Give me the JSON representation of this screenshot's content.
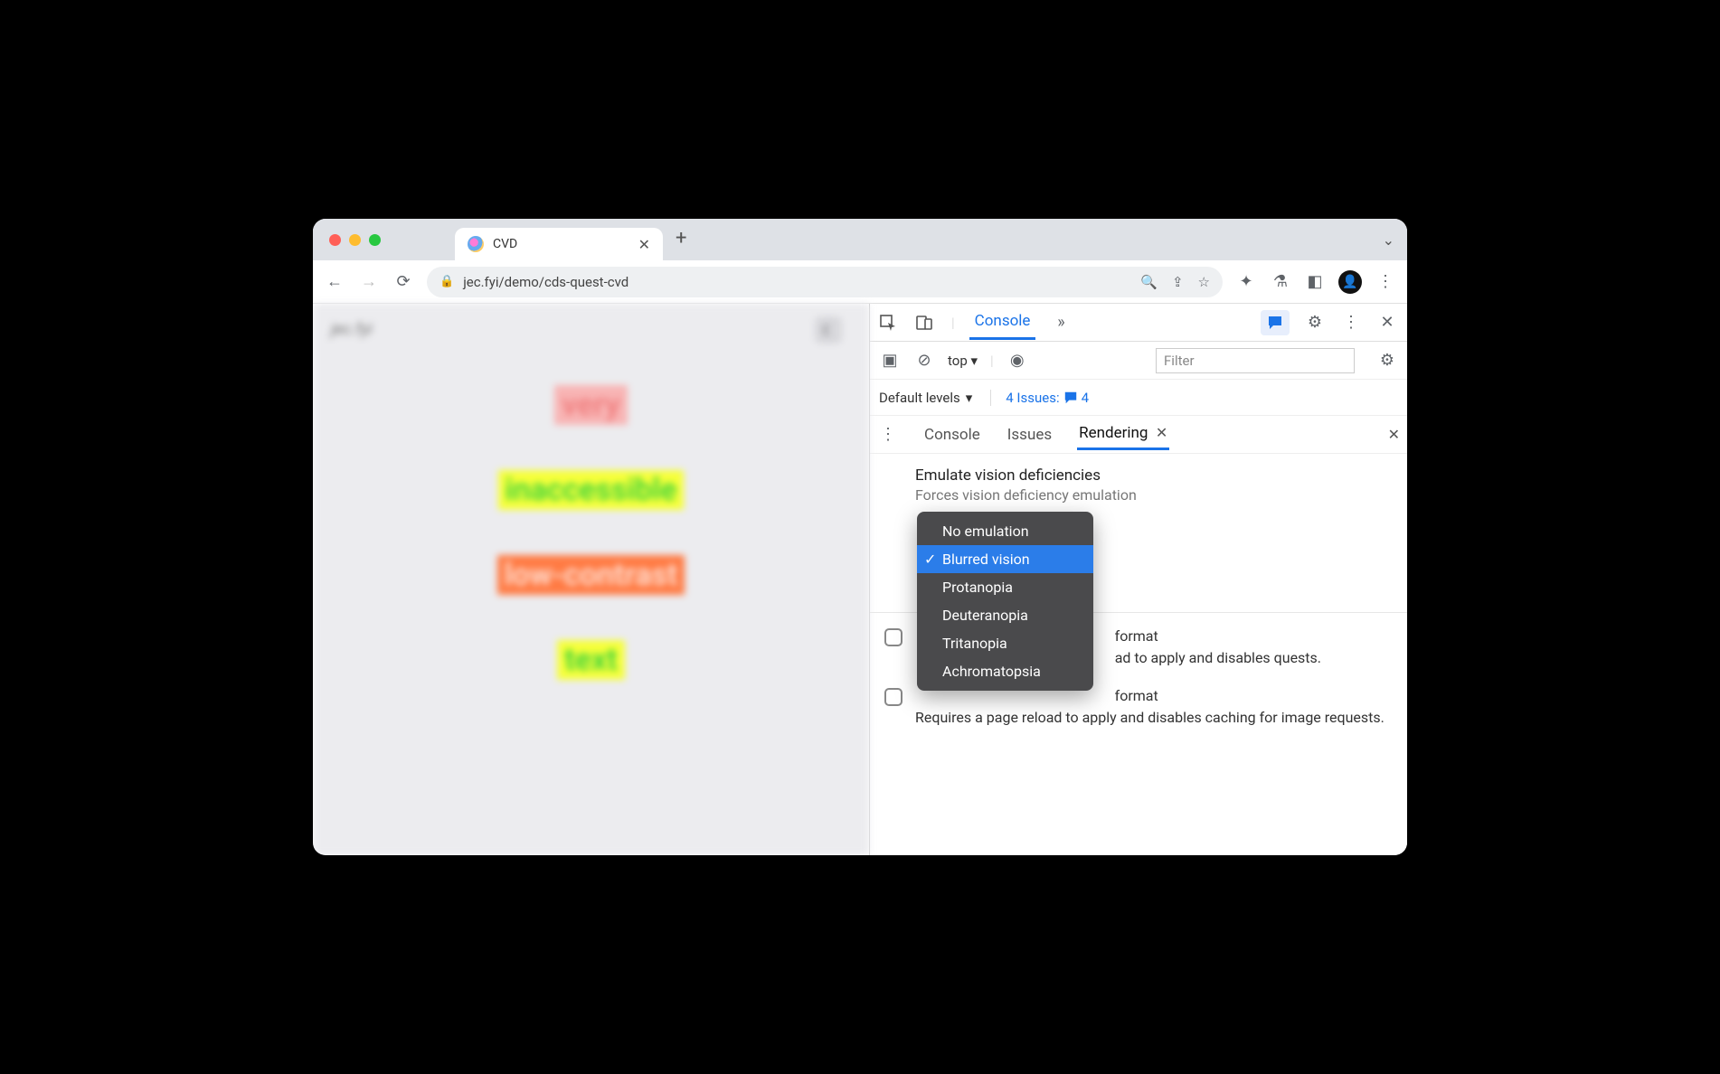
{
  "browser": {
    "tab_title": "CVD",
    "url_display": "jec.fyi/demo/cds-quest-cvd"
  },
  "page": {
    "site_label": "jec.fyi",
    "words": [
      "very",
      "inaccessible",
      "low-contrast",
      "text"
    ]
  },
  "devtools": {
    "main_tab_active": "Console",
    "context": "top",
    "filter_placeholder": "Filter",
    "levels_label": "Default levels",
    "issues_label": "4 Issues:",
    "issues_count": "4",
    "drawer_tabs": [
      "Console",
      "Issues",
      "Rendering"
    ],
    "drawer_active": "Rendering",
    "section_title": "Emulate vision deficiencies",
    "section_sub": "Forces vision deficiency emulation",
    "dropdown_options": [
      "No emulation",
      "Blurred vision",
      "Protanopia",
      "Deuteranopia",
      "Tritanopia",
      "Achromatopsia"
    ],
    "dropdown_selected": "Blurred vision",
    "below1_title_fragment": "format",
    "below1_text": "ad to apply and disables quests.",
    "below2_title_fragment": "format",
    "below2_text": "Requires a page reload to apply and disables caching for image requests."
  }
}
